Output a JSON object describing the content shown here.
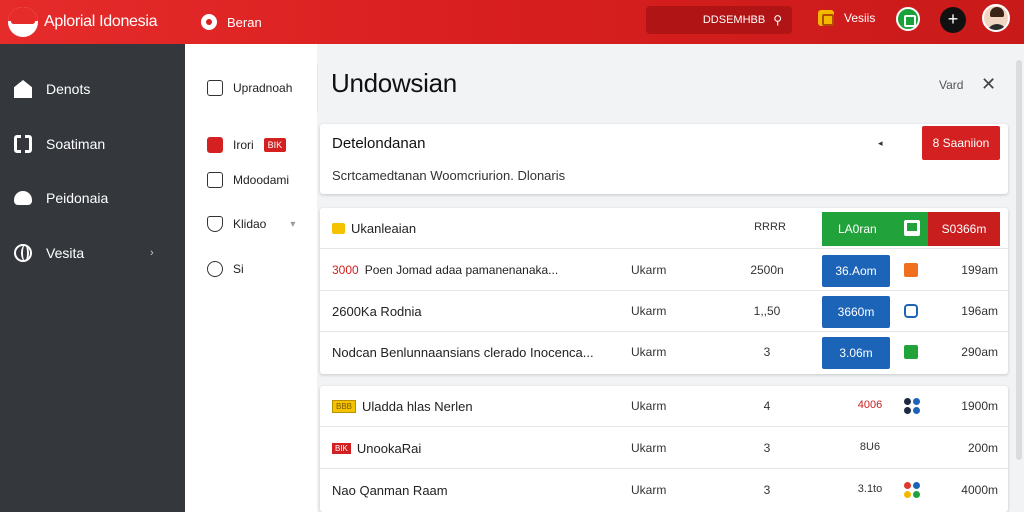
{
  "header": {
    "brand": "Aplorial Idonesia",
    "nav_label": "Beran",
    "search_placeholder": "DDSEMHBB",
    "notif_label": "Vesiis"
  },
  "sidebar": {
    "items": [
      {
        "label": "Denots",
        "icon": "home-icon"
      },
      {
        "label": "Soatiman",
        "icon": "grid-icon"
      },
      {
        "label": "Peidonaia",
        "icon": "car-icon"
      },
      {
        "label": "Vesita",
        "icon": "globe-icon"
      }
    ]
  },
  "subnav": {
    "items": [
      {
        "label": "Upradnoah"
      },
      {
        "label": "Irori",
        "badge": "BIK"
      },
      {
        "label": "Mdoodami"
      },
      {
        "label": "Klidao"
      },
      {
        "label": "Si"
      }
    ]
  },
  "main": {
    "title": "Undowsian",
    "vert_label": "Vard",
    "card": {
      "title": "Detelondanan",
      "subtitle": "Scrtcamedtanan Woomcriurion. Dlonaris",
      "button": "8 Saaniion"
    },
    "table1": {
      "header": {
        "name": "Ukanleaian",
        "code": "RRRR",
        "green": "LA0ran",
        "red": "S0366m"
      },
      "rows": [
        {
          "prefix": "3000",
          "name": "Poen Jomad adaa pamanenanaka...",
          "type": "Ukarm",
          "qty": "2500n",
          "pill": "36.Aom",
          "dist": "199am"
        },
        {
          "prefix": "",
          "name": "2600Ka Rodnia",
          "type": "Ukarm",
          "qty": "1,,50",
          "pill": "3660m",
          "dist": "196am"
        },
        {
          "prefix": "",
          "name": "Nodcan Benlunnaansians clerado Inocenca...",
          "type": "Ukarm",
          "qty": "3",
          "pill": "3.06m",
          "dist": "290am"
        }
      ]
    },
    "table2": {
      "rows": [
        {
          "tag": "BBB",
          "name": "Uladda hlas Nerlen",
          "type": "Ukarm",
          "qty": "4",
          "code": "4006",
          "dist": "1900m"
        },
        {
          "tag": "BIK",
          "name": "UnookaRai",
          "type": "Ukarm",
          "qty": "3",
          "code": "8U6",
          "dist": "200m"
        },
        {
          "tag": "",
          "name": "Nao Qanman Raam",
          "type": "Ukarm",
          "qty": "3",
          "code": "3.1to",
          "dist": "4000m"
        }
      ]
    }
  },
  "colors": {
    "brand_red": "#d91f1f",
    "sidebar": "#34383d",
    "green": "#22a23a",
    "blue": "#1c64b8"
  }
}
